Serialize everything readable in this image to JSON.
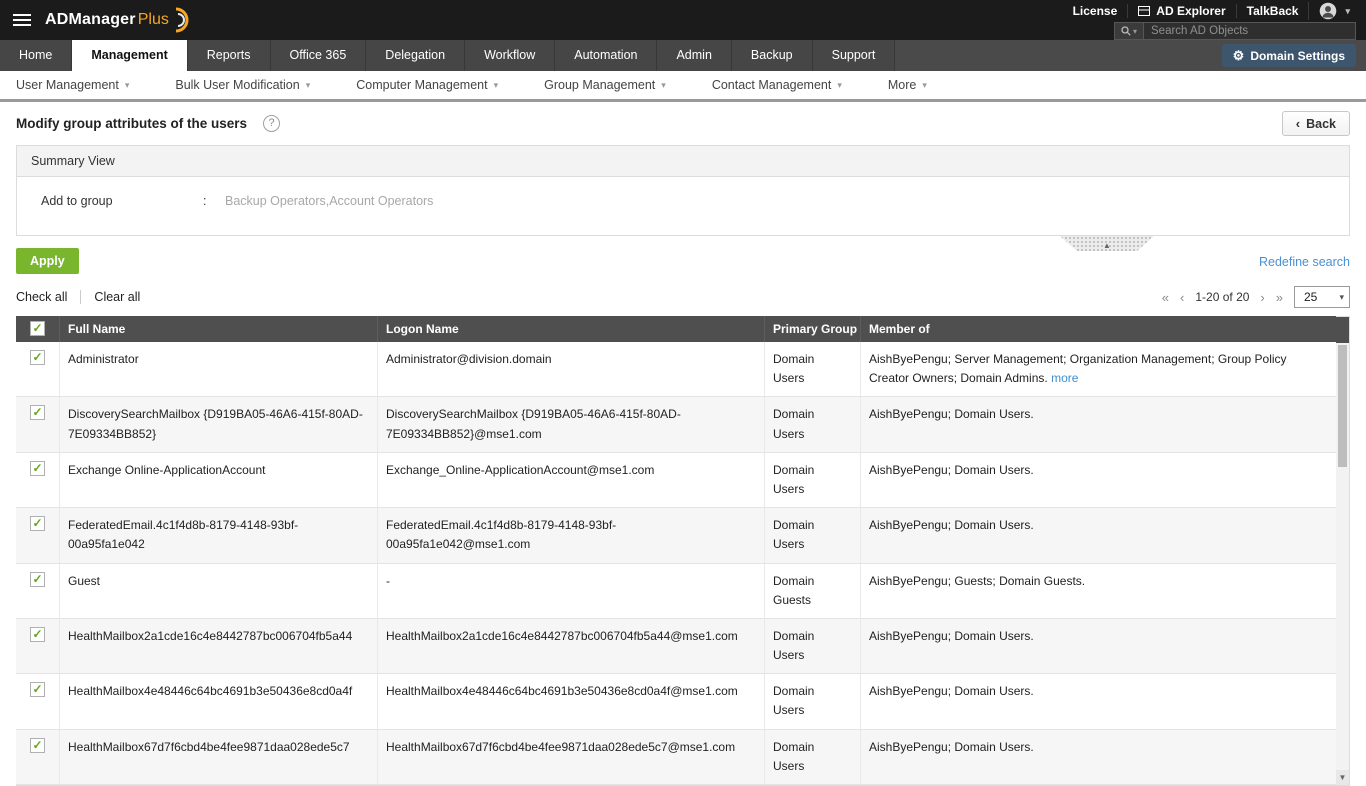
{
  "colors": {
    "brand_orange": "#f5a623",
    "accent_green": "#7ab52e",
    "link_blue": "#3f8fd2",
    "topbar_dark": "#1b1b1b",
    "nav_dark": "#4a4a4a",
    "table_header_dark": "#4f4f4f",
    "domain_settings_blue": "#3d566e"
  },
  "icons": {
    "check": "✓",
    "caret_down": "▾",
    "gear": "⚙",
    "help": "?",
    "back_chevron": "‹",
    "pagination_first": "«",
    "pagination_prev": "‹",
    "pagination_next": "›",
    "pagination_last": "»",
    "collapse_arrow": "▲",
    "scroll_down_arrow": "▼"
  },
  "topbar": {
    "logo_primary": "ADManager",
    "logo_secondary": "Plus",
    "links": {
      "license": "License",
      "ad_explorer": "AD Explorer",
      "talkback": "TalkBack"
    },
    "search_placeholder": "Search AD Objects"
  },
  "nav": {
    "tabs": [
      "Home",
      "Management",
      "Reports",
      "Office 365",
      "Delegation",
      "Workflow",
      "Automation",
      "Admin",
      "Backup",
      "Support"
    ],
    "active_tab": "Management",
    "domain_settings_label": "Domain Settings"
  },
  "subnav": {
    "items": [
      "User Management",
      "Bulk User Modification",
      "Computer Management",
      "Group Management",
      "Contact Management",
      "More"
    ]
  },
  "page": {
    "title": "Modify group attributes of the users",
    "back_label": "Back"
  },
  "summary": {
    "header": "Summary View",
    "field_label": "Add to group",
    "field_colon": ":",
    "field_value": "Backup Operators,Account Operators"
  },
  "actions": {
    "apply_label": "Apply",
    "redefine_label": "Redefine search"
  },
  "toolbar": {
    "check_all": "Check all",
    "clear_all": "Clear all",
    "pagination_info": "1-20 of 20",
    "page_size": "25"
  },
  "table": {
    "headers": {
      "full_name": "Full Name",
      "logon_name": "Logon Name",
      "primary_group": "Primary Group",
      "member_of": "Member of"
    },
    "rows": [
      {
        "full_name": "Administrator",
        "logon_name": "Administrator@division.domain",
        "primary_group": "Domain Users",
        "member_of": "AishByePengu; Server Management; Organization Management; Group Policy Creator Owners; Domain Admins.",
        "more": "more"
      },
      {
        "full_name": "DiscoverySearchMailbox {D919BA05-46A6-415f-80AD-7E09334BB852}",
        "logon_name": "DiscoverySearchMailbox {D919BA05-46A6-415f-80AD-7E09334BB852}@mse1.com",
        "primary_group": "Domain Users",
        "member_of": "AishByePengu; Domain Users."
      },
      {
        "full_name": "Exchange Online-ApplicationAccount",
        "logon_name": "Exchange_Online-ApplicationAccount@mse1.com",
        "primary_group": "Domain Users",
        "member_of": "AishByePengu; Domain Users."
      },
      {
        "full_name": "FederatedEmail.4c1f4d8b-8179-4148-93bf-00a95fa1e042",
        "logon_name": "FederatedEmail.4c1f4d8b-8179-4148-93bf-00a95fa1e042@mse1.com",
        "primary_group": "Domain Users",
        "member_of": "AishByePengu; Domain Users."
      },
      {
        "full_name": "Guest",
        "logon_name": "-",
        "primary_group": "Domain Guests",
        "member_of": "AishByePengu; Guests; Domain Guests."
      },
      {
        "full_name": "HealthMailbox2a1cde16c4e8442787bc006704fb5a44",
        "logon_name": "HealthMailbox2a1cde16c4e8442787bc006704fb5a44@mse1.com",
        "primary_group": "Domain Users",
        "member_of": "AishByePengu; Domain Users."
      },
      {
        "full_name": "HealthMailbox4e48446c64bc4691b3e50436e8cd0a4f",
        "logon_name": "HealthMailbox4e48446c64bc4691b3e50436e8cd0a4f@mse1.com",
        "primary_group": "Domain Users",
        "member_of": "AishByePengu; Domain Users."
      },
      {
        "full_name": "HealthMailbox67d7f6cbd4be4fee9871daa028ede5c7",
        "logon_name": "HealthMailbox67d7f6cbd4be4fee9871daa028ede5c7@mse1.com",
        "primary_group": "Domain Users",
        "member_of": "AishByePengu; Domain Users."
      }
    ]
  }
}
